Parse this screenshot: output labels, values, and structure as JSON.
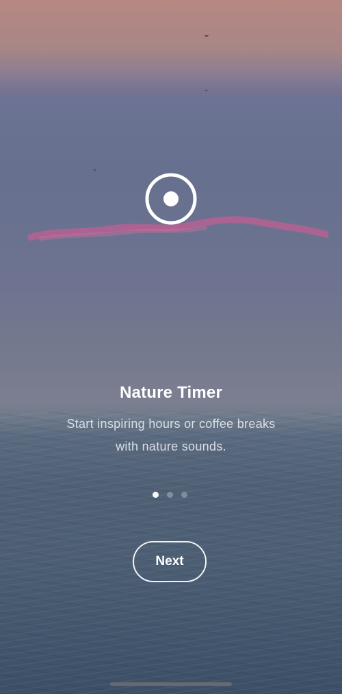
{
  "onboarding": {
    "title": "Nature Timer",
    "subtitle_line1": "Start inspiring hours or coffee breaks",
    "subtitle_line2": "with nature sounds.",
    "page_indicator": {
      "total": 3,
      "active_index": 0
    },
    "next_label": "Next"
  },
  "icons": {
    "logo": "circle-dot-icon"
  },
  "colors": {
    "text_primary": "#ffffff",
    "sky_top": "#b78882",
    "sea": "#44576d"
  }
}
